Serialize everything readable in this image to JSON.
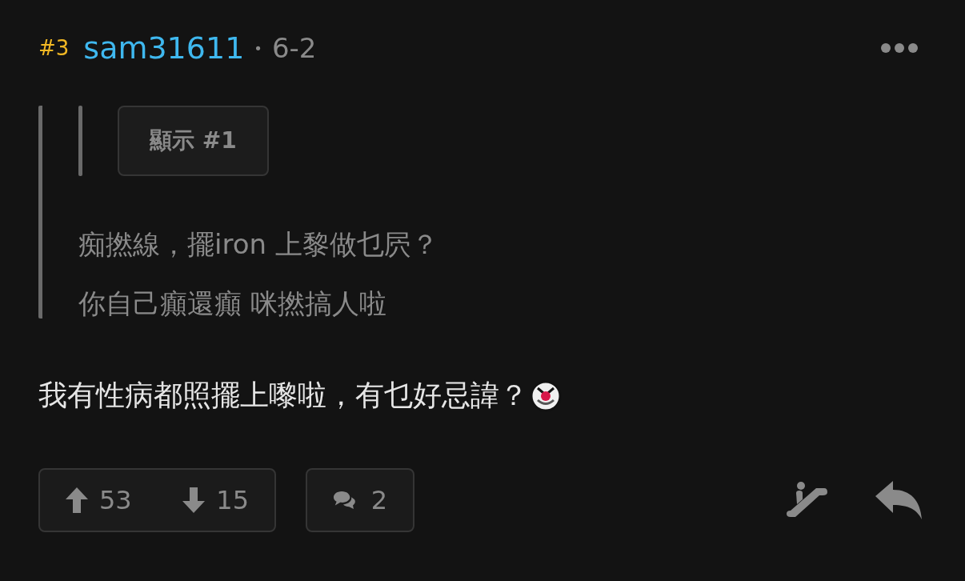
{
  "post": {
    "floor": "#3",
    "username": "sam31611",
    "separator": "•",
    "date": "6-2"
  },
  "quote": {
    "show_button": "顯示 #1",
    "lines": [
      "痴撚線，擺iron 上黎做乜屄？",
      "你自己癲還癲 咪撚搞人啦"
    ]
  },
  "body": "我有性病都照擺上嚟啦，有乜好忌諱？",
  "footer": {
    "upvotes": "53",
    "downvotes": "15",
    "replies": "2"
  }
}
